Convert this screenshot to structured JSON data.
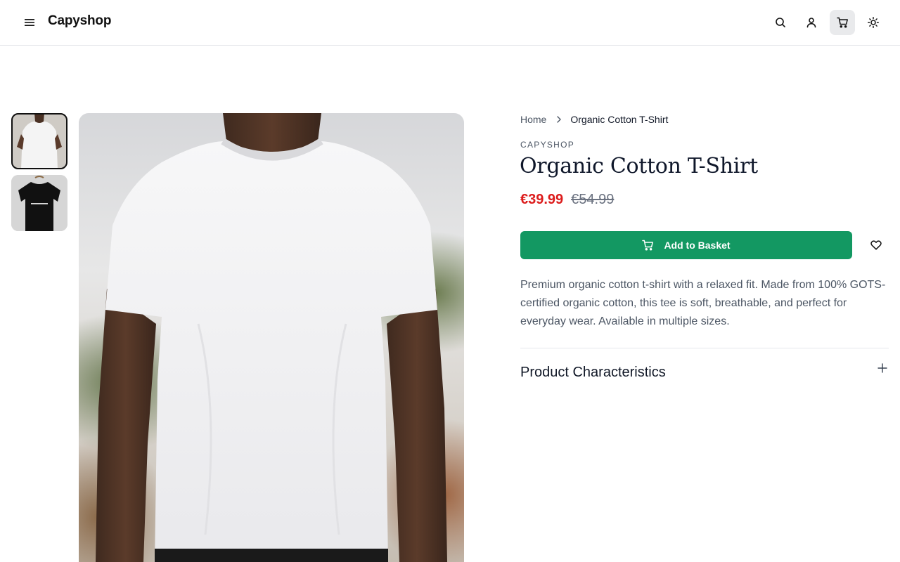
{
  "header": {
    "brand": "Capyshop",
    "icons": [
      "menu-icon",
      "search-icon",
      "user-icon",
      "cart-icon",
      "sun-icon"
    ]
  },
  "gallery": {
    "thumbnails": [
      {
        "name": "white-tshirt-front",
        "selected": true
      },
      {
        "name": "black-tshirt-hanger",
        "selected": false
      }
    ]
  },
  "breadcrumb": {
    "home": "Home",
    "current": "Organic Cotton T-Shirt"
  },
  "product": {
    "brand": "CAPYSHOP",
    "title": "Organic Cotton T-Shirt",
    "price": "€39.99",
    "original_price": "€54.99",
    "add_to_basket": "Add to Basket",
    "description": "Premium organic cotton t-shirt with a relaxed fit. Made from 100% GOTS-certified organic cotton, this tee is soft, breathable, and perfect for everyday wear. Available in multiple sizes.",
    "characteristics_title": "Product Characteristics"
  },
  "colors": {
    "accent": "#139862",
    "sale": "#dc1c1c"
  }
}
